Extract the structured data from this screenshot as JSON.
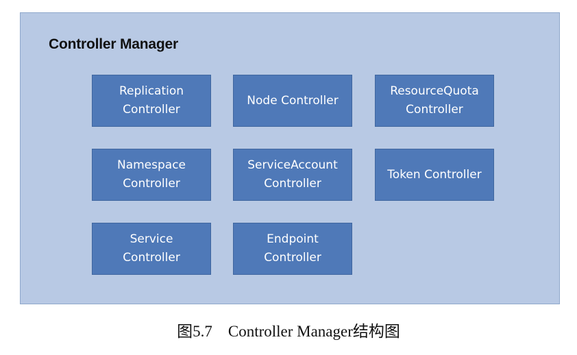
{
  "diagram": {
    "title": "Controller Manager",
    "components": [
      "Replication\nController",
      "Node Controller",
      "ResourceQuota\nController",
      "Namespace\nController",
      "ServiceAccount\nController",
      "Token Controller",
      "Service\nController",
      "Endpoint\nController"
    ],
    "colors": {
      "panel_background": "#b8c9e4",
      "component_fill": "#4f79b8",
      "component_text": "#ffffff"
    }
  },
  "caption": "图5.7    Controller Manager结构图"
}
